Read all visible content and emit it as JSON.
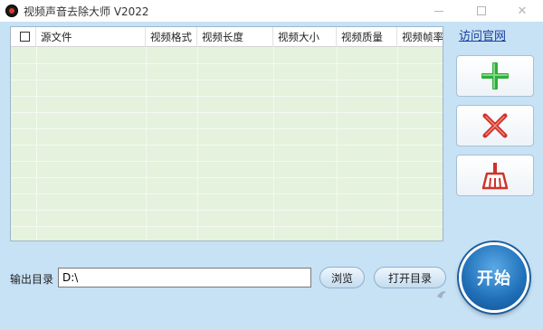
{
  "window": {
    "title": "视频声音去除大师 V2022",
    "minimize_icon": "minimize-icon",
    "maximize_icon": "maximize-icon",
    "close_icon": "close-icon",
    "close_glyph": "✕"
  },
  "file_table": {
    "columns": [
      "源文件",
      "视频格式",
      "视频长度",
      "视频大小",
      "视频质量",
      "视频帧率"
    ],
    "rows": []
  },
  "sidebar": {
    "visit_link": "访问官网",
    "add_icon": "plus-icon",
    "delete_icon": "cross-icon",
    "clear_icon": "broom-icon",
    "add_color": "#2fae3a",
    "delete_color": "#d0322a",
    "clear_color": "#d0322a"
  },
  "output": {
    "label": "输出目录",
    "value": "D:\\",
    "browse_label": "浏览",
    "open_dir_label": "打开目录"
  },
  "start": {
    "label": "开始",
    "color": "#1f6fb8"
  }
}
